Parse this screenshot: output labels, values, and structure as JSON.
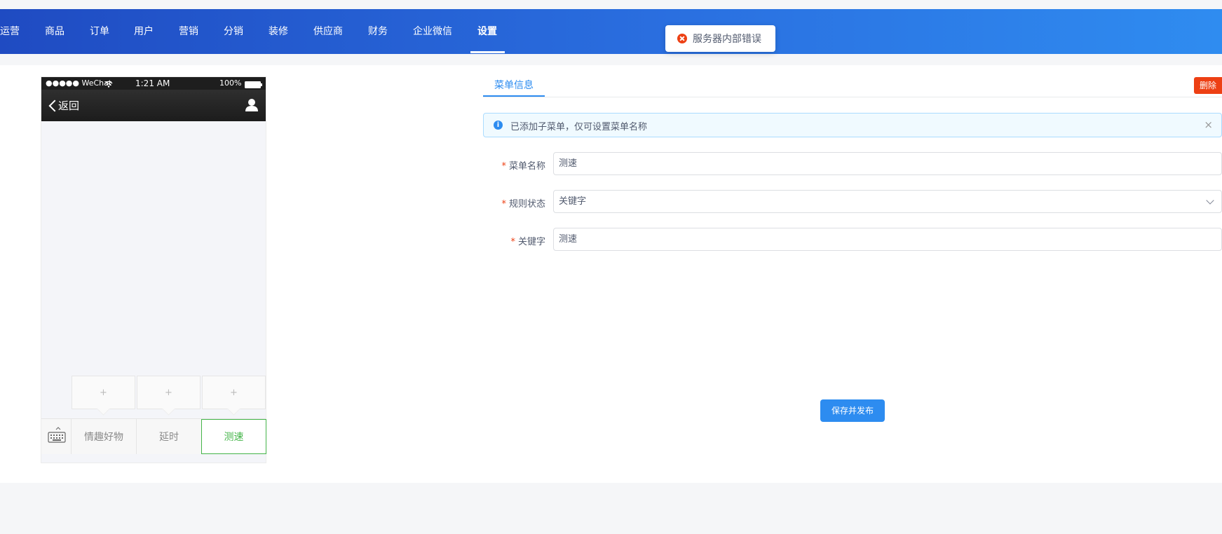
{
  "nav": {
    "items": [
      "运营",
      "商品",
      "订单",
      "用户",
      "营销",
      "分销",
      "装修",
      "供应商",
      "财务",
      "企业微信",
      "设置"
    ],
    "active": "设置"
  },
  "toast": {
    "message": "服务器内部错误",
    "icon": "error-circle-icon",
    "color": "#ed4014"
  },
  "phone": {
    "carrier": "●●●●● WeChat",
    "time": "1:21 AM",
    "battery": "100%",
    "back_label": "返回",
    "add_glyph": "+",
    "menu": [
      "情趣好物",
      "延时",
      "测速"
    ],
    "active_menu": "测速",
    "active_color": "#44b549"
  },
  "tabs": {
    "active": "菜单信息"
  },
  "delete_label": "删除",
  "alert": {
    "text": "已添加子菜单，仅可设置菜单名称",
    "close": "×"
  },
  "form": {
    "required_mark": "*",
    "fields": [
      {
        "label": "菜单名称",
        "value": "测速"
      },
      {
        "label": "规则状态",
        "value": "关键字"
      },
      {
        "label": "关键字",
        "value": "测速"
      }
    ]
  },
  "save_label": "保存并发布",
  "colors": {
    "primary": "#2d8cf0",
    "danger": "#ed4014",
    "nav_start": "#1f4bc2",
    "nav_end": "#2f8cf0"
  }
}
